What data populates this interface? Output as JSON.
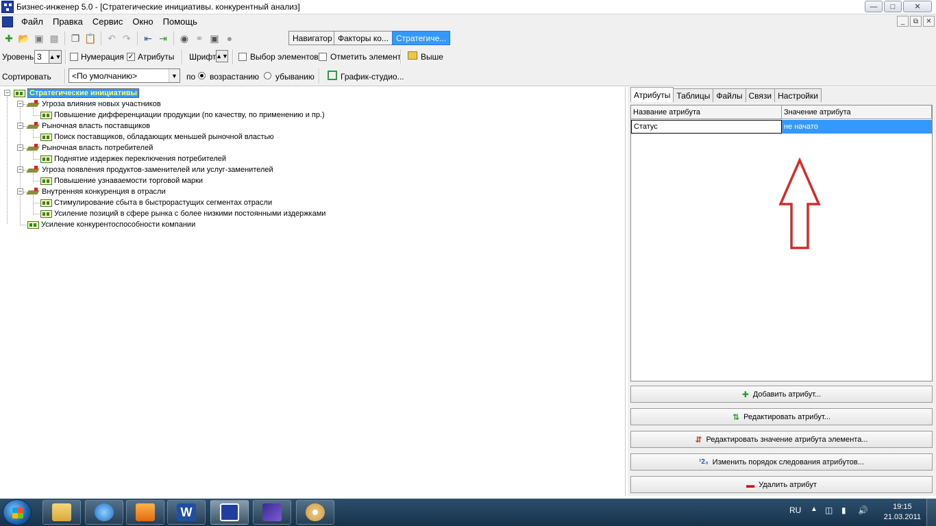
{
  "window": {
    "title": "Бизнес-инженер 5.0 - [Стратегические инициативы. конкурентный анализ]",
    "controls": [
      "minimize",
      "maximize",
      "close"
    ]
  },
  "menu": [
    "Файл",
    "Правка",
    "Сервис",
    "Окно",
    "Помощь"
  ],
  "toolbar": {
    "icons": [
      "new-icon",
      "open-icon",
      "save-icon",
      "save-all-icon",
      "copy-icon",
      "paste-icon",
      "undo-icon",
      "redo-icon",
      "move-left-icon",
      "move-right-icon",
      "find-icon",
      "link-icon",
      "camera-icon",
      "globe-icon"
    ],
    "nav_tabs": [
      {
        "label": "Навигатор",
        "active": false
      },
      {
        "label": "Факторы ко...",
        "active": false
      },
      {
        "label": "Стратегиче...",
        "active": true
      }
    ]
  },
  "toolbar2": {
    "level_label": "Уровень",
    "level_value": "3",
    "numbering_label": "Нумерация",
    "numbering_checked": false,
    "attributes_label": "Атрибуты",
    "attributes_checked": true,
    "font_label": "Шрифт",
    "select_elements_label": "Выбор элементов",
    "mark_element_label": "Отметить элемент",
    "up_label": "Выше"
  },
  "toolbar3": {
    "sort_label": "Сортировать",
    "sort_value": "<По умолчанию>",
    "by_label": "по",
    "ascending_label": "возрастанию",
    "descending_label": "убыванию",
    "order": "ascending",
    "graph_studio_label": "График-студио..."
  },
  "tree": [
    {
      "label": "Стратегические инициативы",
      "level": 0,
      "type": "group",
      "expanded": true,
      "selected": true
    },
    {
      "label": "Угроза влияния новых участников",
      "level": 1,
      "type": "factor",
      "expanded": true
    },
    {
      "label": "Повышение  дифференциации  продукции  (по качеству,  по применению и пр.)",
      "level": 2,
      "type": "group"
    },
    {
      "label": "Рыночная власть поставщиков",
      "level": 1,
      "type": "factor",
      "expanded": true
    },
    {
      "label": "Поиск поставщиков, обладающих  меньшей рыночной властью",
      "level": 2,
      "type": "group"
    },
    {
      "label": "Рыночная власть потребителей",
      "level": 1,
      "type": "factor",
      "expanded": true
    },
    {
      "label": "Поднятие издержек переключения потребителей",
      "level": 2,
      "type": "group"
    },
    {
      "label": "Угроза появления продуктов-заменителей или услуг-заменителей",
      "level": 1,
      "type": "factor",
      "expanded": true
    },
    {
      "label": "Повышение узнаваемости торговой марки",
      "level": 2,
      "type": "group"
    },
    {
      "label": "Внутренняя конкуренция в отрасли",
      "level": 1,
      "type": "factor",
      "expanded": true
    },
    {
      "label": "Стимулирование сбыта  в быстрорастущих сегментах отрасли",
      "level": 2,
      "type": "group"
    },
    {
      "label": "Усиление позиций в сфере рынка  с более низкими постоянными издержками",
      "level": 2,
      "type": "group"
    },
    {
      "label": "Усиление   конкурентоспособности   компании",
      "level": 1,
      "type": "group"
    }
  ],
  "right_panel": {
    "tabs": [
      {
        "label": "Атрибуты",
        "active": true
      },
      {
        "label": "Таблицы",
        "active": false
      },
      {
        "label": "Файлы",
        "active": false
      },
      {
        "label": "Связи",
        "active": false
      },
      {
        "label": "Настройки",
        "active": false
      }
    ],
    "grid": {
      "headers": [
        "Название атрибута",
        "Значение атрибута"
      ],
      "rows": [
        [
          "Статус",
          "не начато"
        ]
      ]
    },
    "actions": [
      {
        "label": "Добавить атрибут...",
        "icon": "plus-icon",
        "color": "#2a9a2a"
      },
      {
        "label": "Редактировать атрибут...",
        "icon": "sort-arrows-icon",
        "color": "#2a9a2a"
      },
      {
        "label": "Редактировать значение атрибута элемента...",
        "icon": "edit-value-icon",
        "color": "#c8381f"
      },
      {
        "label": "Изменить порядок следования атрибутов...",
        "icon": "order-123-icon",
        "color": "#2255aa"
      },
      {
        "label": "Удалить атрибут",
        "icon": "minus-icon",
        "color": "#cc1111"
      }
    ]
  },
  "taskbar": {
    "apps": [
      "explorer-icon",
      "internet-explorer-icon",
      "media-player-icon",
      "word-icon",
      "business-engineer-icon",
      "drawing-app-icon",
      "paint-icon"
    ],
    "language": "RU",
    "time": "19:15",
    "date": "21.03.2011"
  }
}
